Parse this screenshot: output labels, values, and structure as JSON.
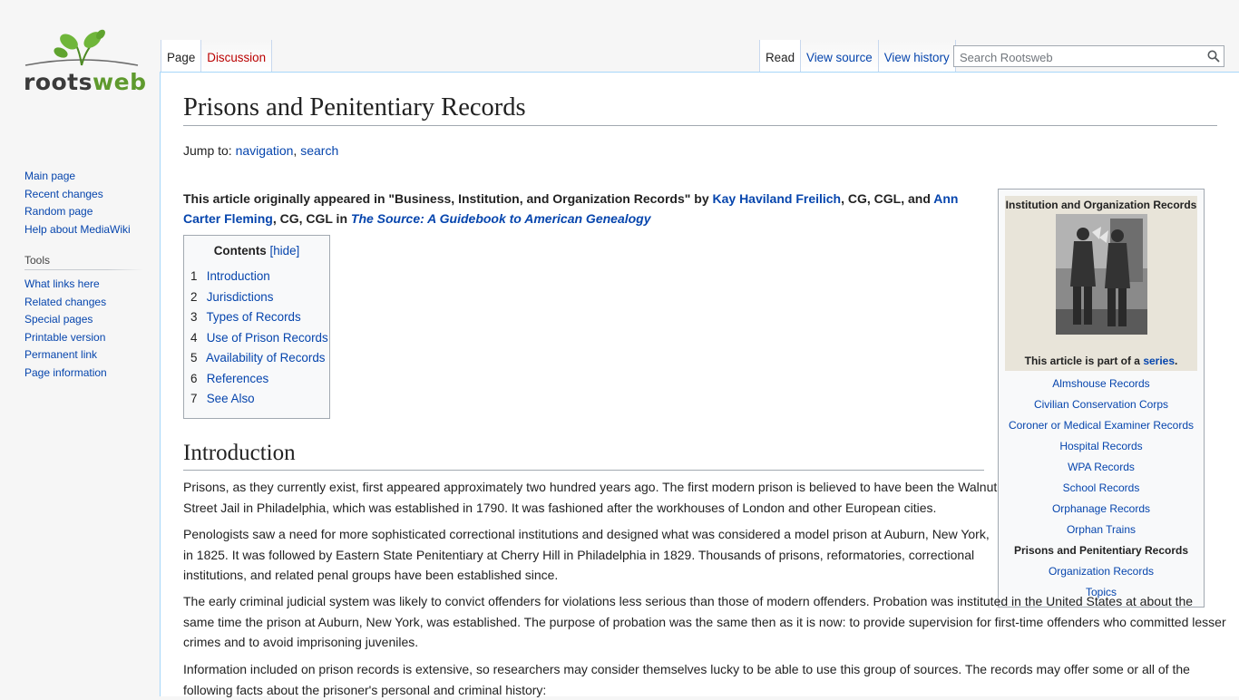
{
  "site": {
    "logo_text_a": "roots",
    "logo_text_b": "web"
  },
  "sidebar": {
    "navigation": [
      "Main page",
      "Recent changes",
      "Random page",
      "Help about MediaWiki"
    ],
    "tools_heading": "Tools",
    "tools": [
      "What links here",
      "Related changes",
      "Special pages",
      "Printable version",
      "Permanent link",
      "Page information"
    ]
  },
  "tabs": {
    "page": "Page",
    "discussion": "Discussion",
    "read": "Read",
    "view_source": "View source",
    "view_history": "View history"
  },
  "search": {
    "placeholder": "Search Rootsweb"
  },
  "article": {
    "title": "Prisons and Penitentiary Records",
    "jump_to": "Jump to:",
    "jump_navigation": "navigation",
    "jump_sep": ", ",
    "jump_search": "search",
    "note": {
      "prefix": "This article originally appeared in \"Business, Institution, and Organization Records\" by ",
      "author1": "Kay Haviland Freilich",
      "mid": ", CG, CGL, and ",
      "author2": "Ann Carter Fleming",
      "mid2": ", CG, CGL in ",
      "source": "The Source: A Guidebook to American Genealogy"
    },
    "toc": {
      "title": "Contents",
      "hide": "[hide]",
      "items": [
        {
          "num": "1",
          "label": "Introduction"
        },
        {
          "num": "2",
          "label": "Jurisdictions"
        },
        {
          "num": "3",
          "label": "Types of Records"
        },
        {
          "num": "4",
          "label": "Use of Prison Records"
        },
        {
          "num": "5",
          "label": "Availability of Records"
        },
        {
          "num": "6",
          "label": "References"
        },
        {
          "num": "7",
          "label": "See Also"
        }
      ]
    },
    "infobox": {
      "title": "Institution and Organization Records",
      "note_prefix": "This article is part of a ",
      "note_link": "series",
      "note_suffix": ".",
      "links": [
        "Almshouse Records",
        "Civilian Conservation Corps",
        "Coroner or Medical Examiner Records",
        "Hospital Records",
        "WPA Records",
        "School Records",
        "Orphanage Records",
        "Orphan Trains",
        "Prisons and Penitentiary Records",
        "Organization Records",
        "Topics"
      ],
      "current_index": 8
    },
    "section_intro": "Introduction",
    "paragraphs": [
      "Prisons, as they currently exist, first appeared approximately two hundred years ago. The first modern prison is believed to have been the Walnut Street Jail in Philadelphia, which was established in 1790. It was fashioned after the workhouses of London and other European cities.",
      "Penologists saw a need for more sophisticated correctional institutions and designed what was considered a model prison at Auburn, New York, in 1825. It was followed by Eastern State Penitentiary at Cherry Hill in Philadelphia in 1829. Thousands of prisons, reformatories, correctional institutions, and related penal groups have been established since.",
      "The early criminal judicial system was likely to convict offenders for violations less serious than those of modern offenders. Probation was instituted in the United States at about the same time the prison at Auburn, New York, was established. The purpose of probation was the same then as it is now: to provide supervision for first-time offenders who committed lesser crimes and to avoid imprisoning juveniles.",
      "Information included on prison records is extensive, so researchers may consider themselves lucky to be able to use this group of sources. The records may offer some or all of the following facts about the prisoner's personal and criminal history:"
    ]
  }
}
